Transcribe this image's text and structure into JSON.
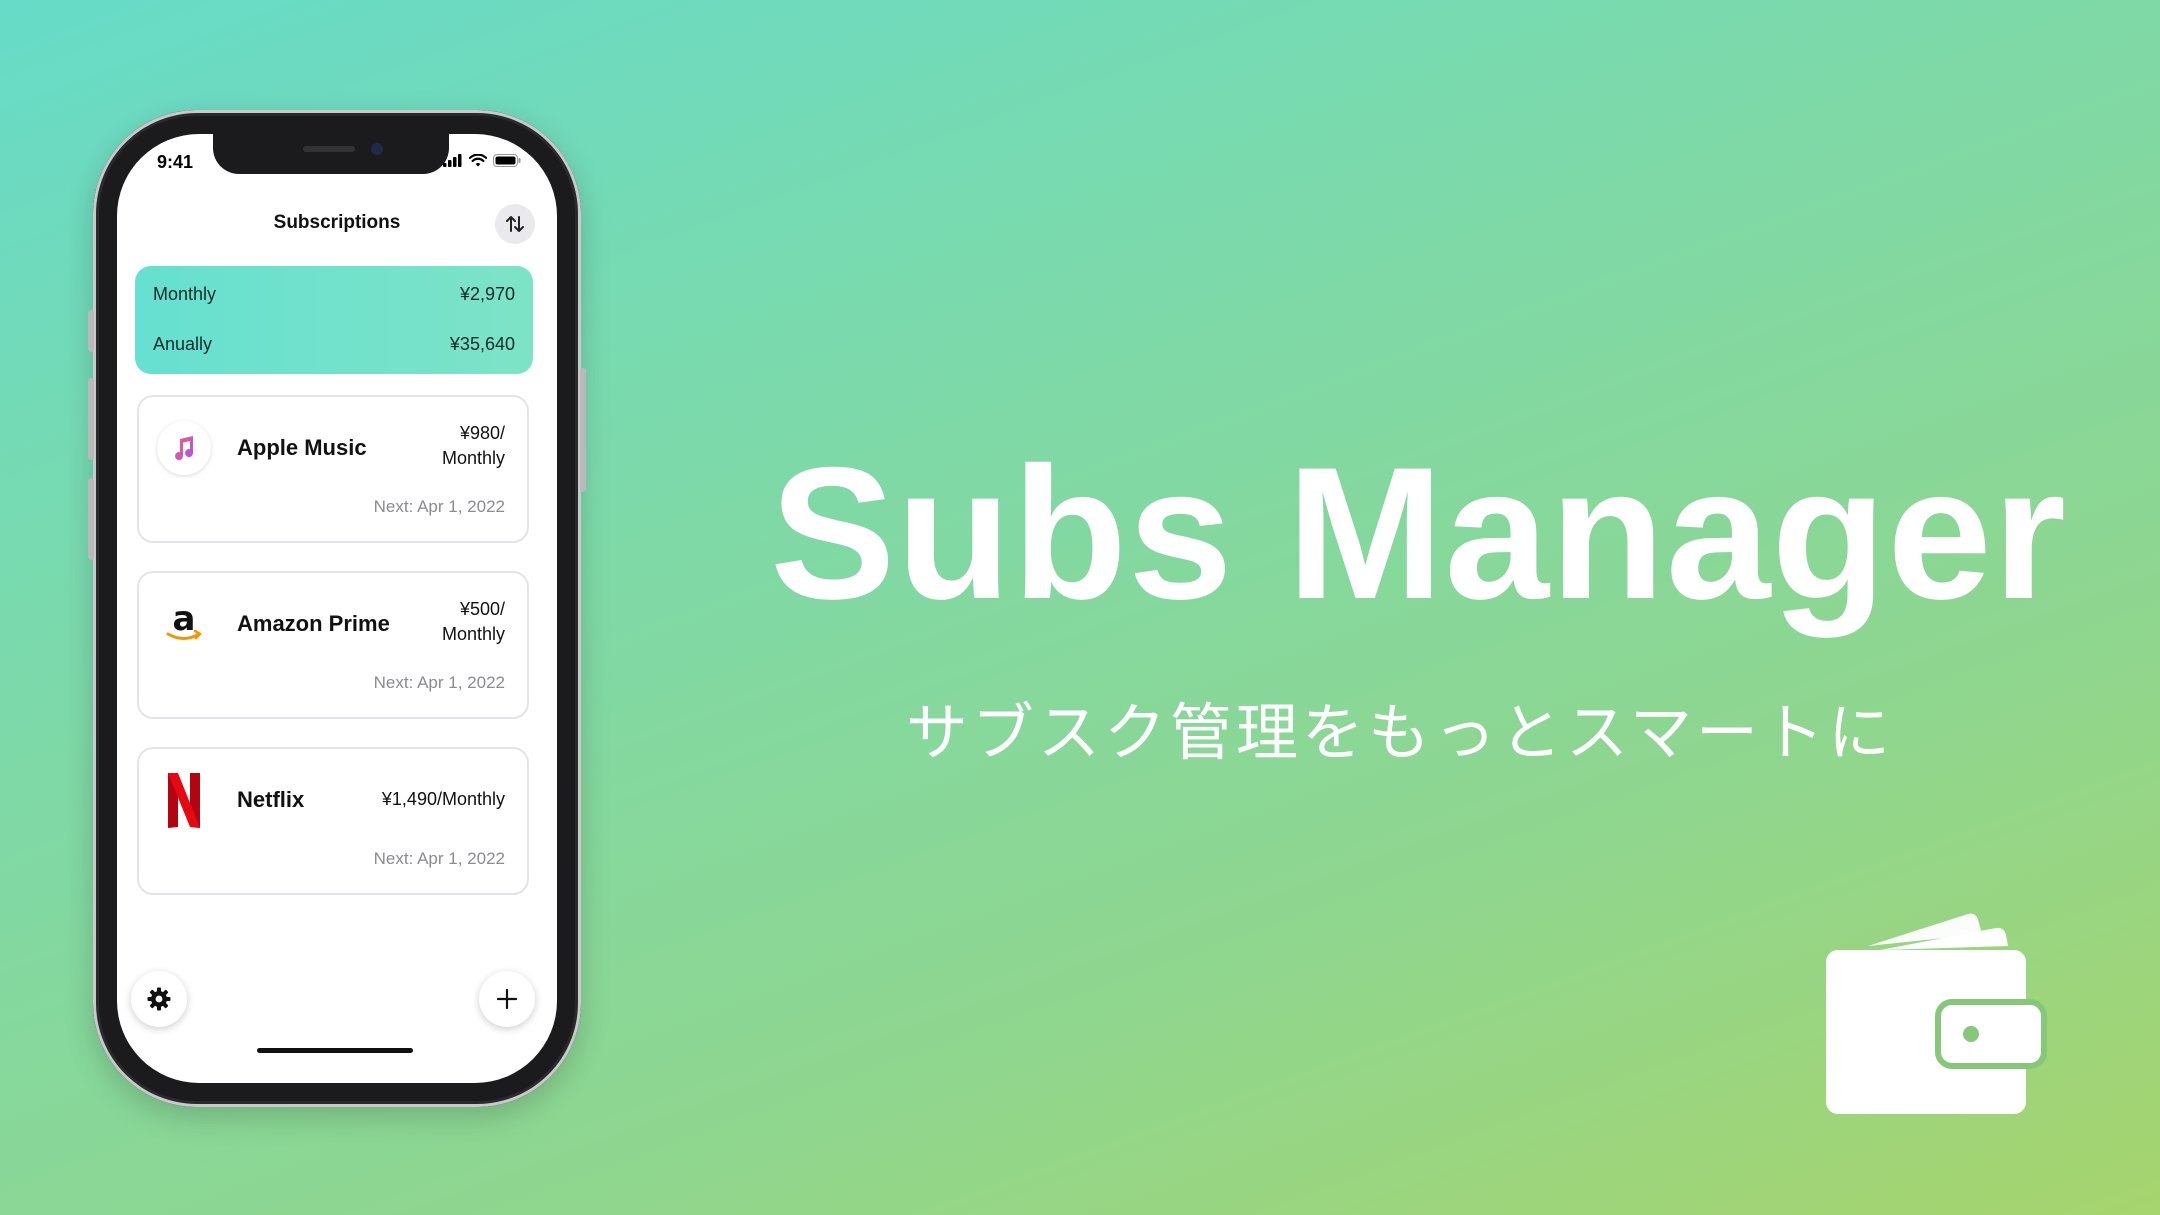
{
  "promo": {
    "title": "Subs Manager",
    "tagline": "サブスク管理をもっとスマートに"
  },
  "status_bar": {
    "time": "9:41"
  },
  "nav": {
    "title": "Subscriptions",
    "sort_icon": "sort-arrows-icon"
  },
  "summary": {
    "monthly_label": "Monthly",
    "monthly_value": "¥2,970",
    "annual_label": "Anually",
    "annual_value": "¥35,640"
  },
  "subscriptions": [
    {
      "name": "Apple Music",
      "price_line1": "¥980/",
      "price_line2": "Monthly",
      "next": "Next: Apr 1, 2022",
      "icon": "apple-music-icon"
    },
    {
      "name": "Amazon Prime",
      "price_line1": "¥500/",
      "price_line2": "Monthly",
      "next": "Next: Apr 1, 2022",
      "icon": "amazon-icon"
    },
    {
      "name": "Netflix",
      "price_line1": "¥1,490/Monthly",
      "next": "Next: Apr 1, 2022",
      "icon": "netflix-icon"
    }
  ],
  "toolbar": {
    "settings_icon": "gear-icon",
    "add_icon": "plus-icon"
  },
  "colors": {
    "summary_gradient": [
      "#66e0d1",
      "#7de3c6"
    ],
    "background_gradient": [
      "#67dbc8",
      "#a6d46e"
    ],
    "netflix_red": "#d81f26",
    "amazon_orange": "#f79400"
  }
}
